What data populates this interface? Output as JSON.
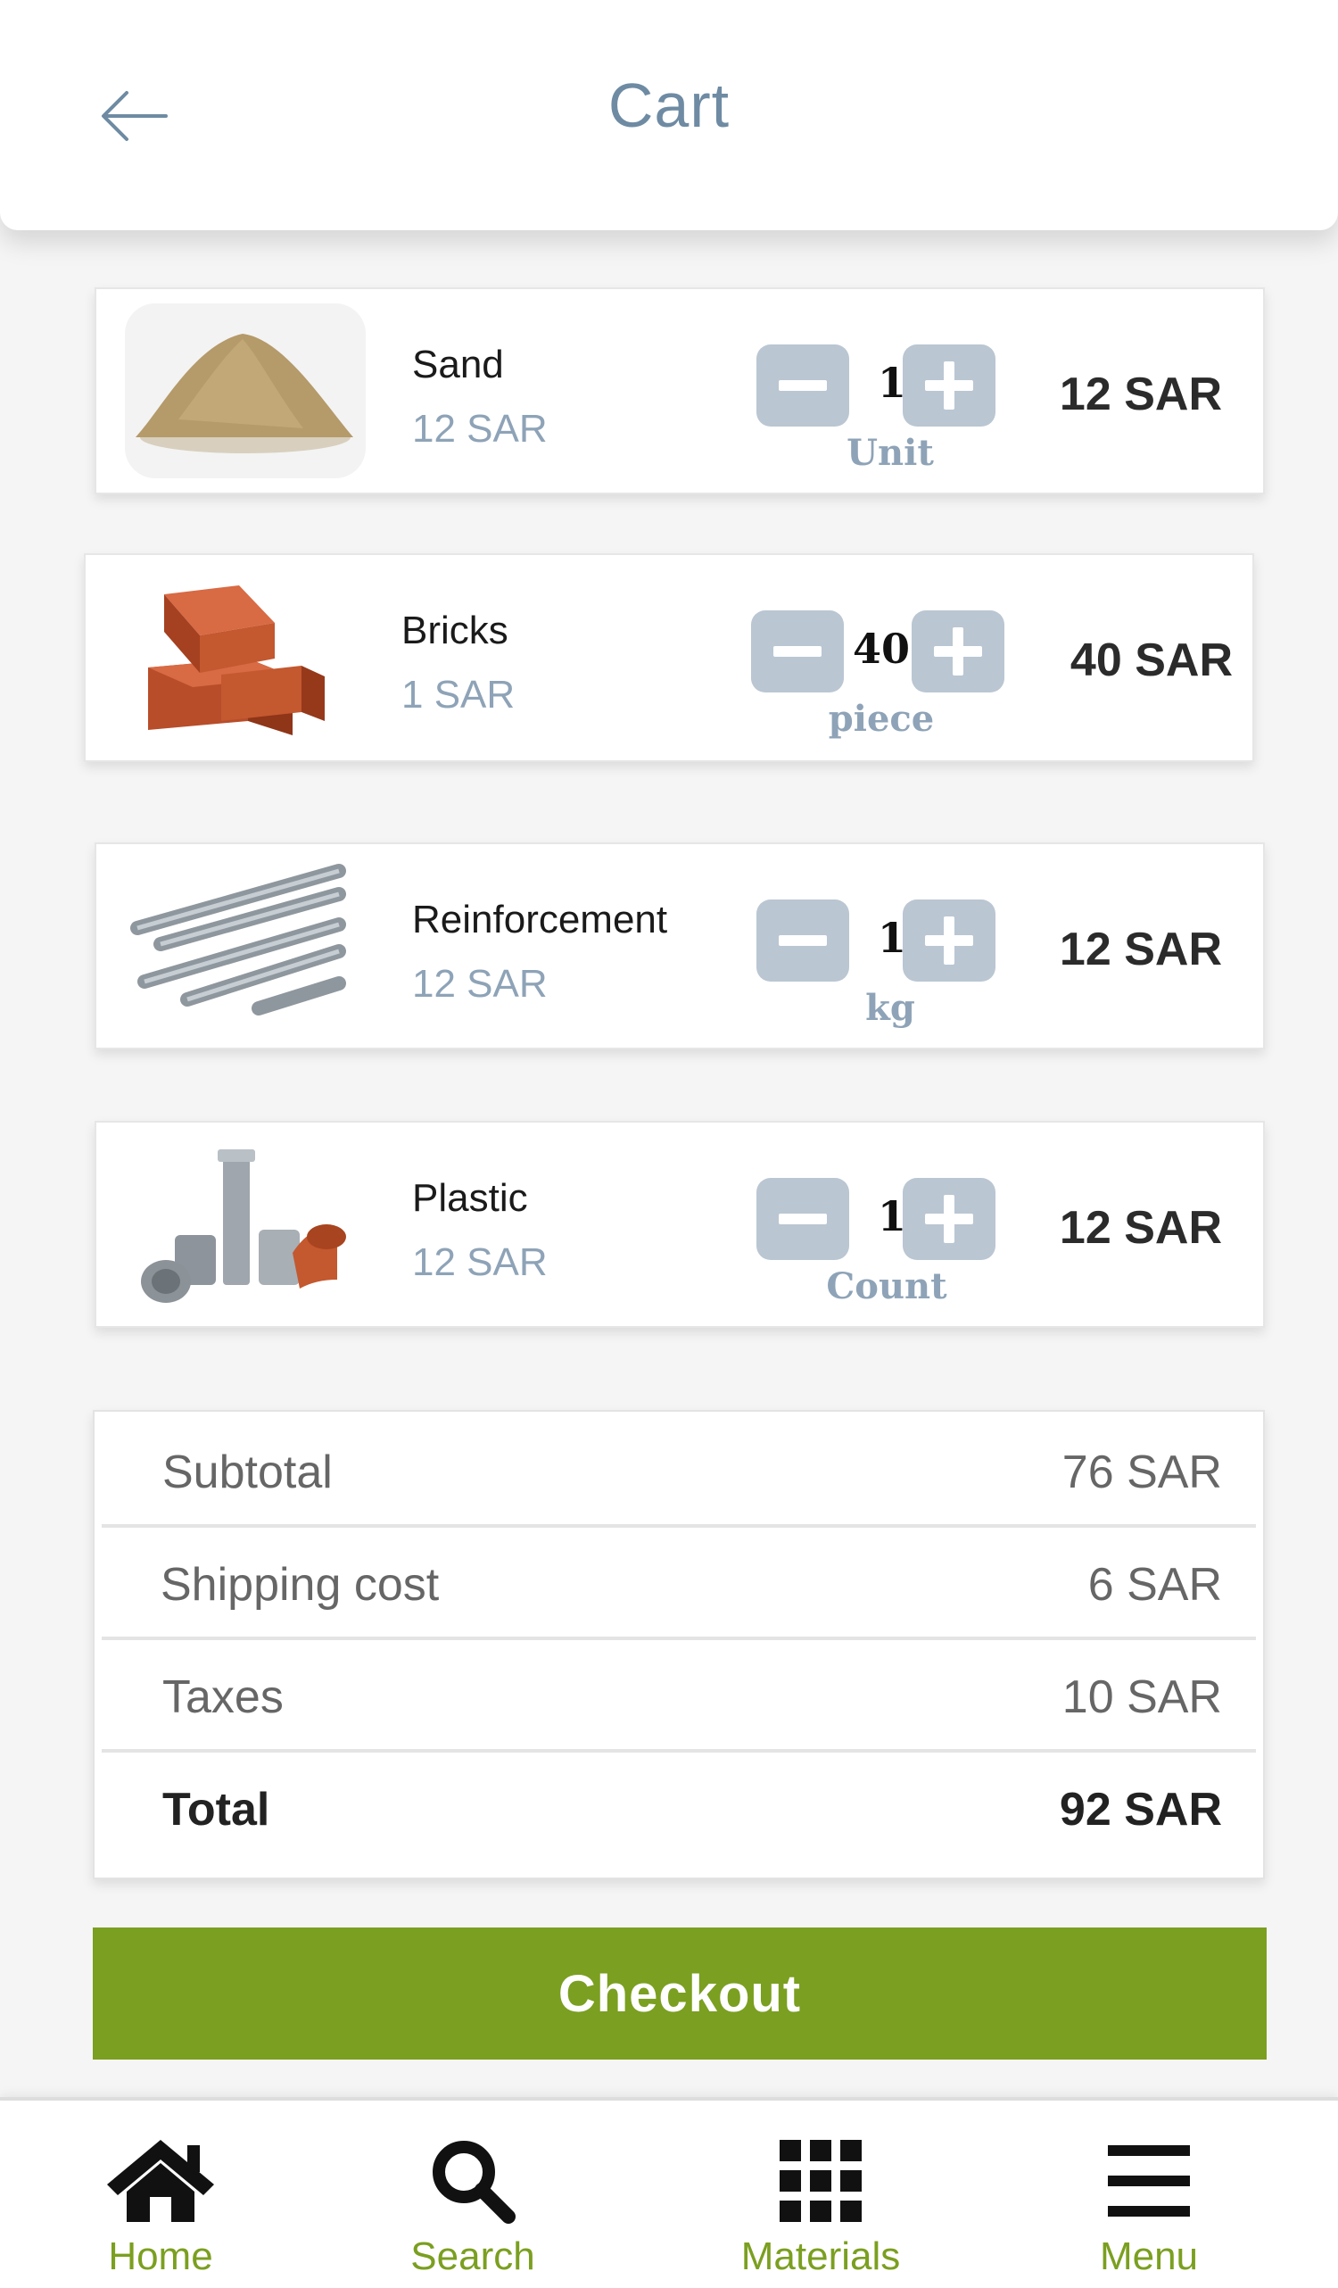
{
  "header": {
    "title": "Cart"
  },
  "items": [
    {
      "name": "Sand",
      "price": "12 SAR",
      "qty": "1",
      "unit": "Unit",
      "total": "12 SAR",
      "image": "sand-pile-image"
    },
    {
      "name": "Bricks",
      "price": "1 SAR",
      "qty": "40",
      "unit": "piece",
      "total": "40 SAR",
      "image": "bricks-stack-image"
    },
    {
      "name": "Reinforcement",
      "price": "12 SAR",
      "qty": "1",
      "unit": "kg",
      "total": "12 SAR",
      "image": "steel-rebar-image"
    },
    {
      "name": "Plastic",
      "price": "12 SAR",
      "qty": "1",
      "unit": "Count",
      "total": "12 SAR",
      "image": "plastic-pipes-image"
    }
  ],
  "summary": {
    "subtotal_label": "Subtotal",
    "subtotal_value": "76 SAR",
    "shipping_label": "Shipping cost",
    "shipping_value": "6 SAR",
    "taxes_label": "Taxes",
    "taxes_value": "10 SAR",
    "total_label": "Total",
    "total_value": "92 SAR"
  },
  "checkout_label": "Checkout",
  "nav": [
    {
      "label": "Home",
      "icon": "home-icon"
    },
    {
      "label": "Search",
      "icon": "search-icon"
    },
    {
      "label": "Materials",
      "icon": "grid-icon"
    },
    {
      "label": "Menu",
      "icon": "menu-icon"
    }
  ],
  "colors": {
    "accent": "#7b9f20",
    "title": "#6e8ba3",
    "muted_price": "#8ea3b7",
    "qty_button": "#bac6d2"
  }
}
